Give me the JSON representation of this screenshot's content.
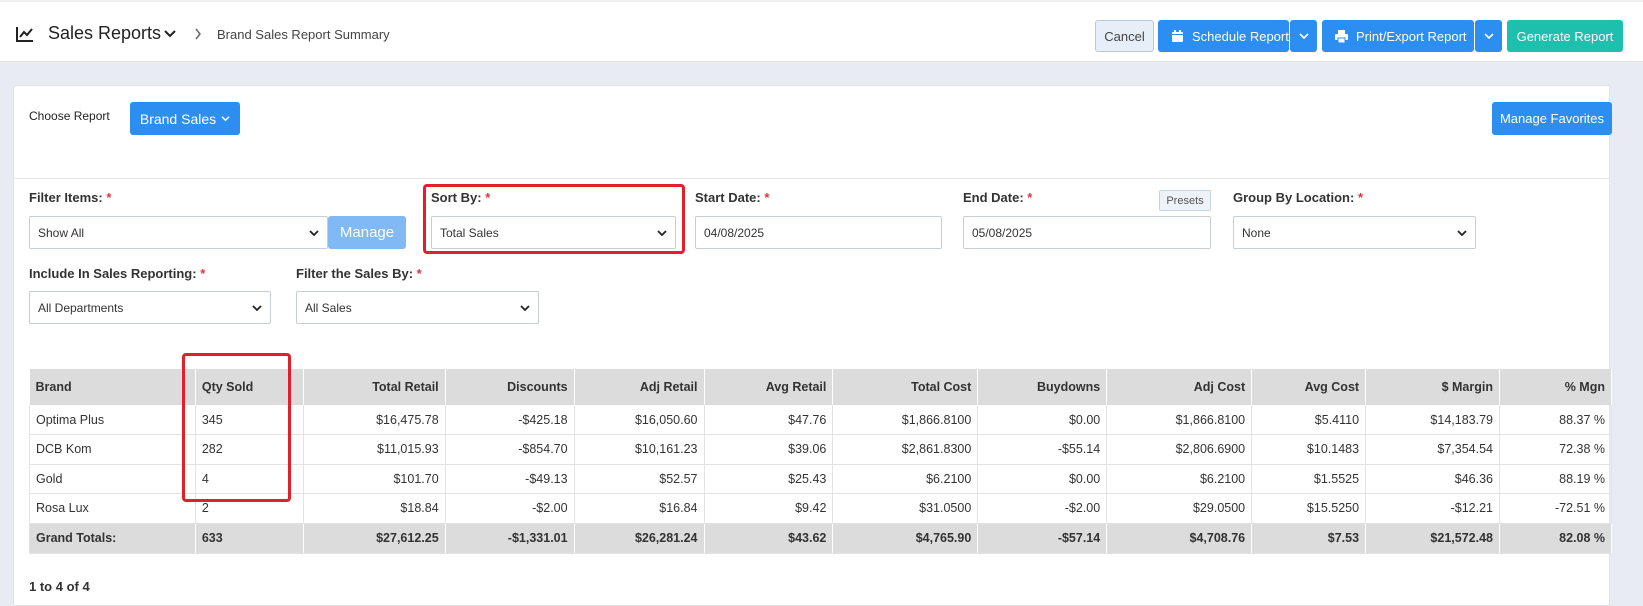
{
  "header": {
    "title": "Sales Reports",
    "breadcrumb": "Brand Sales Report Summary",
    "cancel_label": "Cancel",
    "schedule_label": "Schedule Report",
    "print_label": "Print/Export Report",
    "generate_label": "Generate Report"
  },
  "report": {
    "choose_label": "Choose Report",
    "selected": "Brand Sales",
    "manage_favorites": "Manage Favorites"
  },
  "filters": {
    "filter_items_label": "Filter Items:",
    "filter_items_value": "Show All",
    "manage_label": "Manage",
    "sort_by_label": "Sort By:",
    "sort_by_value": "Total Sales",
    "start_date_label": "Start Date:",
    "start_date_value": "04/08/2025",
    "end_date_label": "End Date:",
    "end_date_value": "05/08/2025",
    "presets_label": "Presets",
    "group_by_label": "Group By Location:",
    "group_by_value": "None",
    "include_label": "Include In Sales Reporting:",
    "include_value": "All Departments",
    "filter_sales_label": "Filter the Sales By:",
    "filter_sales_value": "All Sales",
    "required_mark": "*"
  },
  "table": {
    "columns": [
      "Brand",
      "Qty Sold",
      "Total Retail",
      "Discounts",
      "Adj Retail",
      "Avg Retail",
      "Total Cost",
      "Buydowns",
      "Adj Cost",
      "Avg Cost",
      "$ Margin",
      "% Mgn"
    ],
    "rows": [
      [
        "Optima Plus",
        "345",
        "$16,475.78",
        "-$425.18",
        "$16,050.60",
        "$47.76",
        "$1,866.8100",
        "$0.00",
        "$1,866.8100",
        "$5.4110",
        "$14,183.79",
        "88.37 %"
      ],
      [
        "DCB Kom",
        "282",
        "$11,015.93",
        "-$854.70",
        "$10,161.23",
        "$39.06",
        "$2,861.8300",
        "-$55.14",
        "$2,806.6900",
        "$10.1483",
        "$7,354.54",
        "72.38 %"
      ],
      [
        "Gold",
        "4",
        "$101.70",
        "-$49.13",
        "$52.57",
        "$25.43",
        "$6.2100",
        "$0.00",
        "$6.2100",
        "$1.5525",
        "$46.36",
        "88.19 %"
      ],
      [
        "Rosa Lux",
        "2",
        "$18.84",
        "-$2.00",
        "$16.84",
        "$9.42",
        "$31.0500",
        "-$2.00",
        "$29.0500",
        "$15.5250",
        "-$12.21",
        "-72.51 %"
      ]
    ],
    "totals": [
      "Grand Totals:",
      "633",
      "$27,612.25",
      "-$1,331.01",
      "$26,281.24",
      "$43.62",
      "$4,765.90",
      "-$57.14",
      "$4,708.76",
      "$7.53",
      "$21,572.48",
      "82.08 %"
    ],
    "pager": "1 to 4 of 4"
  }
}
